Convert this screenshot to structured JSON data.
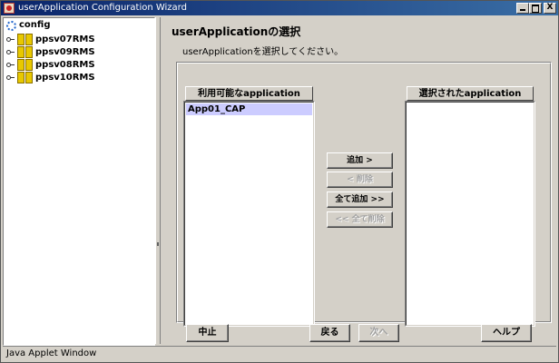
{
  "window": {
    "title": "userApplication Configuration Wizard",
    "controls": {
      "minimize": "",
      "maximize": "",
      "close": "X"
    }
  },
  "tree": {
    "root": "config",
    "nodes": [
      {
        "label": "ppsv07RMS"
      },
      {
        "label": "ppsv09RMS"
      },
      {
        "label": "ppsv08RMS"
      },
      {
        "label": "ppsv10RMS"
      }
    ]
  },
  "main": {
    "heading": "userApplicationの選択",
    "instruction": "userApplicationを選択してください。",
    "available": {
      "header": "利用可能なapplication",
      "items": [
        "App01_CAP"
      ],
      "selected_index": 0
    },
    "selected": {
      "header": "選択されたapplication",
      "items": []
    },
    "buttons": {
      "add": "追加 >",
      "remove": "< 削除",
      "add_all": "全て追加 >>",
      "remove_all": "<< 全て削除"
    },
    "nav": {
      "cancel": "中止",
      "back": "戻る",
      "next": "次へ",
      "help": "ヘルプ"
    }
  },
  "status": "Java Applet Window",
  "colors": {
    "titlebar": "#0a246a",
    "selection": "#ccccff",
    "background": "#d4d0c8"
  }
}
